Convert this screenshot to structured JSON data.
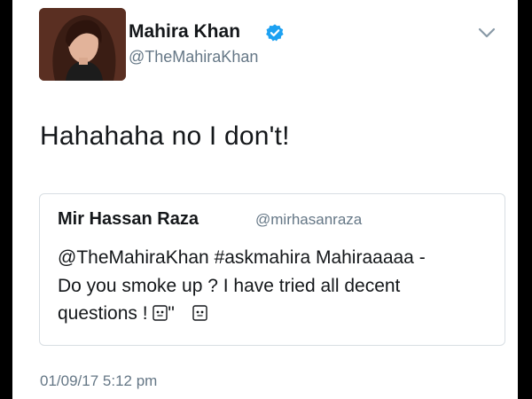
{
  "tweet": {
    "author": {
      "display_name": "Mahira Khan",
      "handle": "@TheMahiraKhan",
      "verified_icon": "verified-badge-icon"
    },
    "text": "Hahahaha no I don't!",
    "timestamp": "01/09/17 5:12 pm",
    "menu_icon": "chevron-down-icon"
  },
  "quoted_tweet": {
    "display_name": "Mir Hassan Raza",
    "handle": "@mirhasanraza",
    "line1": "@TheMahiraKhan #askmahira Mahiraaaaa -",
    "line2": "Do you smoke up ? I have tried all decent",
    "line3_start": "questions ! ",
    "line3_mid": "\"",
    "emoji_icon": "missing-glyph-icon"
  },
  "colors": {
    "verified_blue": "#1da1f2",
    "text": "#14171a",
    "secondary": "#657786",
    "border": "#d8dee3"
  }
}
